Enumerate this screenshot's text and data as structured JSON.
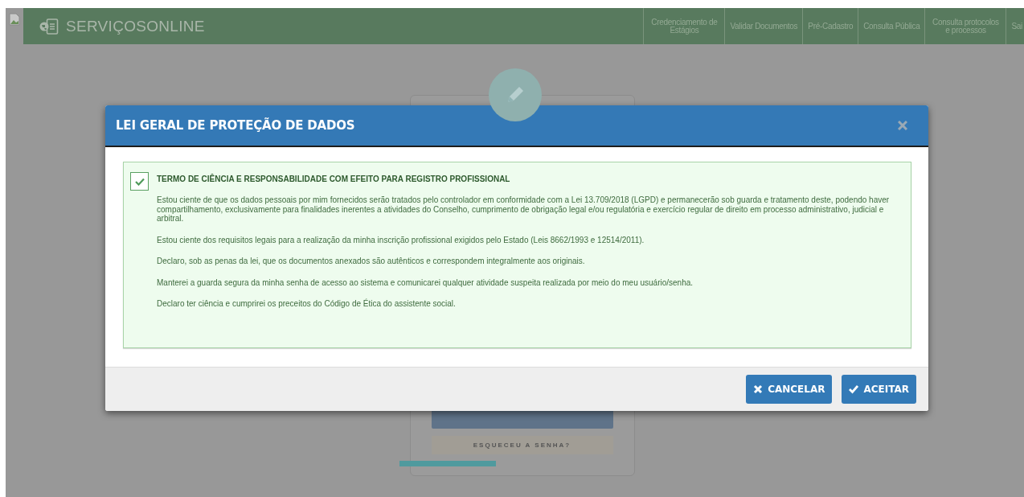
{
  "header": {
    "logo_text": "SERVIÇOSONLINE",
    "nav": [
      {
        "label": "Credenciamento de Estágios"
      },
      {
        "label": "Validar Documentos"
      },
      {
        "label": "Pré-Cadastro"
      },
      {
        "label": "Consulta Pública"
      },
      {
        "label": "Consulta protocolos e processos"
      },
      {
        "label": "Sai"
      }
    ]
  },
  "login_card": {
    "forgot_link": "ESQUECEU A SENHA?"
  },
  "modal": {
    "title": "LEI GERAL DE PROTEÇÃO DE DADOS",
    "term": {
      "checked": true,
      "title": "TERMO DE CIÊNCIA E RESPONSABILIDADE COM EFEITO PARA REGISTRO PROFISSIONAL",
      "paragraphs": [
        "Estou ciente de que os dados pessoais por mim fornecidos serão tratados pelo controlador em conformidade com a Lei 13.709/2018 (LGPD) e permanecerão sob guarda e tratamento deste, podendo haver compartilhamento, exclusivamente para finalidades inerentes a atividades do Conselho, cumprimento de obrigação legal e/ou regulatória e exercício regular de direito em processo administrativo, judicial e arbitral.",
        "Estou ciente dos requisitos legais para a realização da minha inscrição profissional exigidos pelo Estado (Leis 8662/1993 e 12514/2011).",
        "Declaro, sob as penas da lei, que os documentos anexados são autênticos e correspondem integralmente aos originais.",
        "Manterei a guarda segura da minha senha de acesso ao sistema e comunicarei qualquer atividade suspeita realizada por meio do meu usuário/senha.",
        "Declaro ter ciência e cumprirei os preceitos do Código de Ética do assistente social."
      ]
    },
    "buttons": [
      {
        "label": "CANCELAR",
        "kind": "cancel"
      },
      {
        "label": "ACEITAR",
        "kind": "accept"
      }
    ]
  }
}
